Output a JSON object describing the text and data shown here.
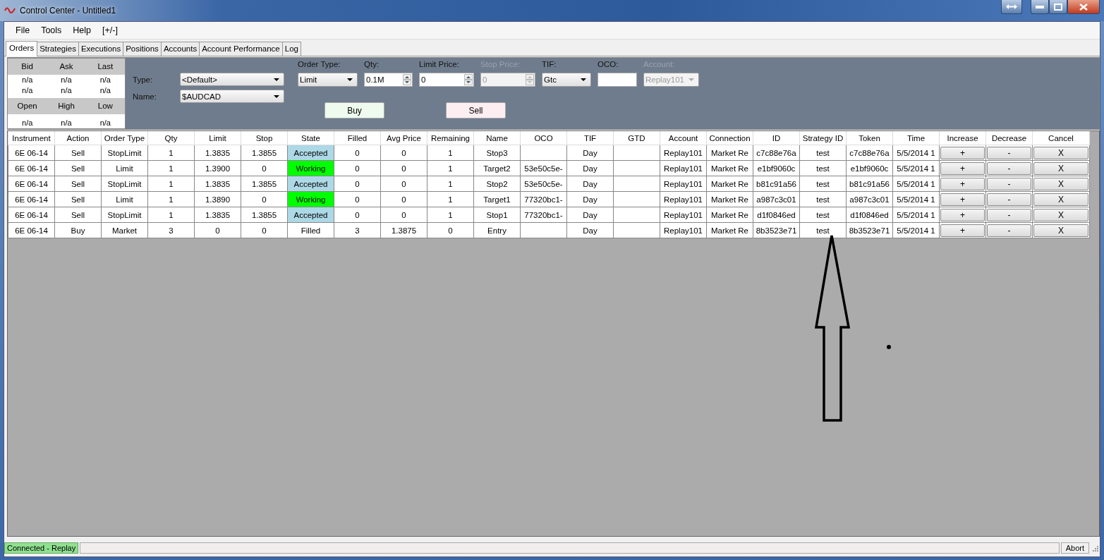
{
  "window": {
    "title": "Control Center - Untitled1"
  },
  "menu": [
    "File",
    "Tools",
    "Help",
    "[+/-]"
  ],
  "tabs": [
    {
      "label": "Orders",
      "selected": true
    },
    {
      "label": "Strategies",
      "selected": false
    },
    {
      "label": "Executions",
      "selected": false
    },
    {
      "label": "Positions",
      "selected": false
    },
    {
      "label": "Accounts",
      "selected": false
    },
    {
      "label": "Account Performance",
      "selected": false
    },
    {
      "label": "Log",
      "selected": false
    }
  ],
  "quote": {
    "headers_1": [
      "Bid",
      "Ask",
      "Last"
    ],
    "rows_1": [
      [
        "n/a",
        "n/a",
        "n/a"
      ],
      [
        "n/a",
        "n/a",
        "n/a"
      ]
    ],
    "headers_2": [
      "Open",
      "High",
      "Low"
    ],
    "rows_2": [
      [
        "n/a",
        "n/a",
        "n/a"
      ]
    ]
  },
  "order_form": {
    "type": {
      "label": "Type:",
      "value": "<Default>"
    },
    "name": {
      "label": "Name:",
      "value": "$AUDCAD"
    },
    "fields": [
      {
        "label": "Order Type:",
        "value": "Limit",
        "kind": "dropdown",
        "disabled": false
      },
      {
        "label": "Qty:",
        "value": "0.1M",
        "kind": "spinner",
        "disabled": false
      },
      {
        "label": "Limit Price:",
        "value": "0",
        "kind": "spinner",
        "disabled": false
      },
      {
        "label": "Stop Price:",
        "value": "0",
        "kind": "spinner",
        "disabled": true
      },
      {
        "label": "TIF:",
        "value": "Gtc",
        "kind": "dropdown",
        "disabled": false
      },
      {
        "label": "OCO:",
        "kind": "text",
        "disabled": false
      },
      {
        "label": "Account:",
        "value": "Replay101",
        "kind": "dropdown",
        "disabled": true
      }
    ],
    "buy_button": "Buy",
    "sell_button": "Sell"
  },
  "table": {
    "columns": [
      "Instrument",
      "Action",
      "Order Type",
      "Qty",
      "Limit",
      "Stop",
      "State",
      "Filled",
      "Avg Price",
      "Remaining",
      "Name",
      "OCO",
      "TIF",
      "GTD",
      "Account",
      "Connection",
      "ID",
      "Strategy ID",
      "Token",
      "Time",
      "Increase",
      "Decrease",
      "Cancel"
    ],
    "rows": [
      {
        "cells": [
          "6E 06-14",
          "Sell",
          "StopLimit",
          "1",
          "1.3835",
          "1.3855",
          "Accepted",
          "0",
          "0",
          "1",
          "Stop3",
          "",
          "Day",
          "",
          "Replay101",
          "Market Re",
          "c7c88e76a",
          "test",
          "c7c88e76a",
          "5/5/2014 1"
        ],
        "color": "#add8e6",
        "buttons": [
          "+",
          "-",
          "X"
        ]
      },
      {
        "cells": [
          "6E 06-14",
          "Sell",
          "Limit",
          "1",
          "1.3900",
          "0",
          "Working",
          "0",
          "0",
          "1",
          "Target2",
          "53e50c5e-",
          "Day",
          "",
          "Replay101",
          "Market Re",
          "e1bf9060c",
          "test",
          "e1bf9060c",
          "5/5/2014 1"
        ],
        "color": "#00ff00",
        "buttons": [
          "+",
          "-",
          "X"
        ]
      },
      {
        "cells": [
          "6E 06-14",
          "Sell",
          "StopLimit",
          "1",
          "1.3835",
          "1.3855",
          "Accepted",
          "0",
          "0",
          "1",
          "Stop2",
          "53e50c5e-",
          "Day",
          "",
          "Replay101",
          "Market Re",
          "b81c91a56",
          "test",
          "b81c91a56",
          "5/5/2014 1"
        ],
        "color": "#add8e6",
        "buttons": [
          "+",
          "-",
          "X"
        ]
      },
      {
        "cells": [
          "6E 06-14",
          "Sell",
          "Limit",
          "1",
          "1.3890",
          "0",
          "Working",
          "0",
          "0",
          "1",
          "Target1",
          "77320bc1-",
          "Day",
          "",
          "Replay101",
          "Market Re",
          "a987c3c01",
          "test",
          "a987c3c01",
          "5/5/2014 1"
        ],
        "color": "#00ff00",
        "buttons": [
          "+",
          "-",
          "X"
        ]
      },
      {
        "cells": [
          "6E 06-14",
          "Sell",
          "StopLimit",
          "1",
          "1.3835",
          "1.3855",
          "Accepted",
          "0",
          "0",
          "1",
          "Stop1",
          "77320bc1-",
          "Day",
          "",
          "Replay101",
          "Market Re",
          "d1f0846ed",
          "test",
          "d1f0846ed",
          "5/5/2014 1"
        ],
        "color": "#add8e6",
        "buttons": [
          "+",
          "-",
          "X"
        ]
      },
      {
        "cells": [
          "6E 06-14",
          "Buy",
          "Market",
          "3",
          "0",
          "0",
          "Filled",
          "3",
          "1.3875",
          "0",
          "Entry",
          "",
          "Day",
          "",
          "Replay101",
          "Market Re",
          "8b3523e71",
          "test",
          "8b3523e71",
          "5/5/2014 1"
        ],
        "buttons": [
          "+",
          "-",
          "X"
        ]
      }
    ]
  },
  "status_bar": {
    "connection": "Connected - Replay",
    "abort_button": "Abort"
  }
}
